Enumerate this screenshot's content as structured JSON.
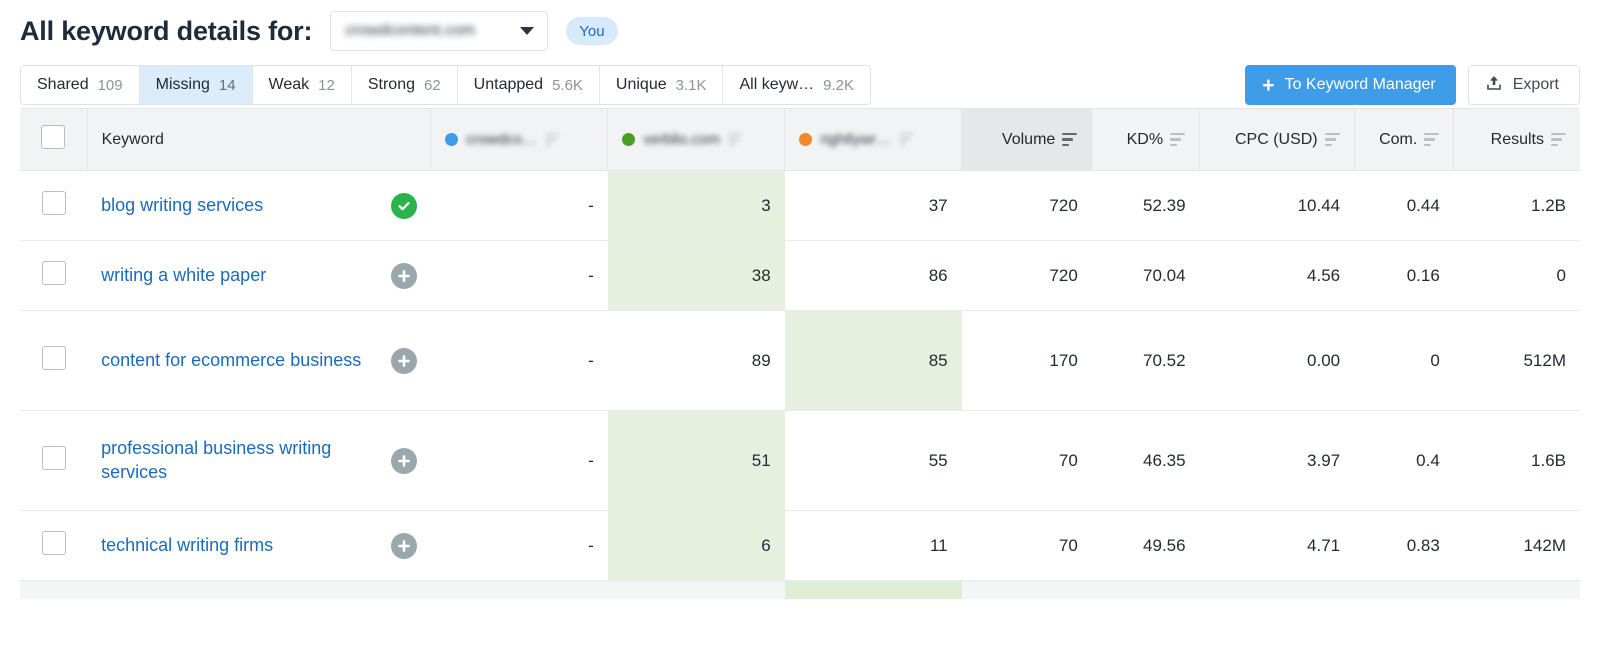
{
  "header": {
    "title": "All keyword details for:",
    "domain_value": "crowdcontent.com",
    "you_badge": "You"
  },
  "tabs": [
    {
      "label": "Shared",
      "count": "109",
      "active": false
    },
    {
      "label": "Missing",
      "count": "14",
      "active": true
    },
    {
      "label": "Weak",
      "count": "12",
      "active": false
    },
    {
      "label": "Strong",
      "count": "62",
      "active": false
    },
    {
      "label": "Untapped",
      "count": "5.6K",
      "active": false
    },
    {
      "label": "Unique",
      "count": "3.1K",
      "active": false
    },
    {
      "label": "All keyw…",
      "count": "9.2K",
      "active": false
    }
  ],
  "actions": {
    "keyword_manager_label": "To Keyword Manager",
    "keyword_manager_icon": "plus-icon",
    "export_label": "Export",
    "export_icon": "export-upload-icon",
    "primary_color": "#3e9ce9"
  },
  "table": {
    "columns": {
      "keyword": "Keyword",
      "volume": "Volume",
      "kd": "KD%",
      "cpc": "CPC (USD)",
      "com": "Com.",
      "results": "Results"
    },
    "sorted_column": "Volume",
    "domains": [
      {
        "name": "crowdco…",
        "dot_color": "#3e9ce9"
      },
      {
        "name": "verblio.com",
        "dot_color": "#4aa023"
      },
      {
        "name": "rightlywr…",
        "dot_color": "#f08a29"
      }
    ],
    "rows": [
      {
        "keyword": "blog writing services",
        "badge": "check-icon",
        "ranks": [
          "-",
          "3",
          "37"
        ],
        "best": 1,
        "volume": "720",
        "kd": "52.39",
        "cpc": "10.44",
        "com": "0.44",
        "results": "1.2B"
      },
      {
        "keyword": "writing a white paper",
        "badge": "plus-icon",
        "ranks": [
          "-",
          "38",
          "86"
        ],
        "best": 1,
        "volume": "720",
        "kd": "70.04",
        "cpc": "4.56",
        "com": "0.16",
        "results": "0"
      },
      {
        "keyword": "content for ecommerce business",
        "badge": "plus-icon",
        "ranks": [
          "-",
          "89",
          "85"
        ],
        "best": 2,
        "volume": "170",
        "kd": "70.52",
        "cpc": "0.00",
        "com": "0",
        "results": "512M"
      },
      {
        "keyword": "professional business writing services",
        "badge": "plus-icon",
        "ranks": [
          "-",
          "51",
          "55"
        ],
        "best": 1,
        "volume": "70",
        "kd": "46.35",
        "cpc": "3.97",
        "com": "0.4",
        "results": "1.6B"
      },
      {
        "keyword": "technical writing firms",
        "badge": "plus-icon",
        "ranks": [
          "-",
          "6",
          "11"
        ],
        "best": 1,
        "volume": "70",
        "kd": "49.56",
        "cpc": "4.71",
        "com": "0.83",
        "results": "142M"
      }
    ]
  }
}
